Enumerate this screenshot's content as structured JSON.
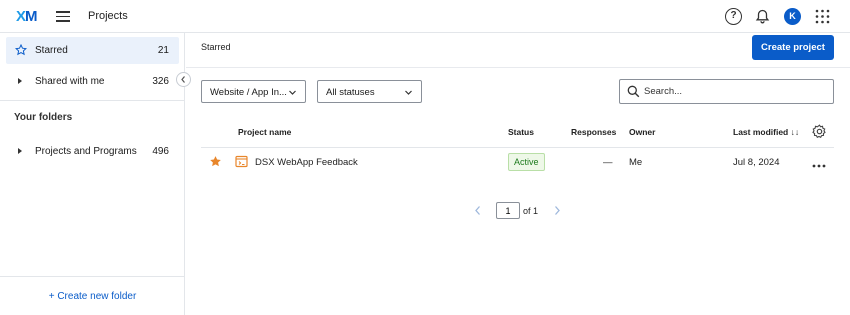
{
  "app": {
    "logo_x": "X",
    "logo_m": "M",
    "title": "Projects"
  },
  "top_icons": {
    "help": "?",
    "avatar_initial": "K"
  },
  "sidebar": {
    "items": [
      {
        "label": "Starred",
        "count": "21"
      },
      {
        "label": "Shared with me",
        "count": "326"
      }
    ],
    "folders_heading": "Your folders",
    "folders": [
      {
        "label": "Projects and Programs",
        "count": "496"
      }
    ],
    "create_folder": "+ Create new folder"
  },
  "main": {
    "breadcrumb": "Starred",
    "create_button": "Create project",
    "filters": {
      "type": "Website / App In...",
      "status": "All statuses"
    },
    "search": {
      "placeholder": "Search...",
      "value": ""
    },
    "columns": {
      "name": "Project name",
      "status": "Status",
      "responses": "Responses",
      "owner": "Owner",
      "modified": "Last modified",
      "modified_sort": "↓↓"
    },
    "rows": [
      {
        "name": "DSX WebApp Feedback",
        "status": "Active",
        "responses": "—",
        "owner": "Me",
        "modified": "Jul 8, 2024"
      }
    ],
    "pagination": {
      "page": "1",
      "of": "of 1"
    }
  },
  "colors": {
    "accent": "#0a5cc9",
    "star": "#e8862b",
    "active_green": "#1d7a1d"
  }
}
